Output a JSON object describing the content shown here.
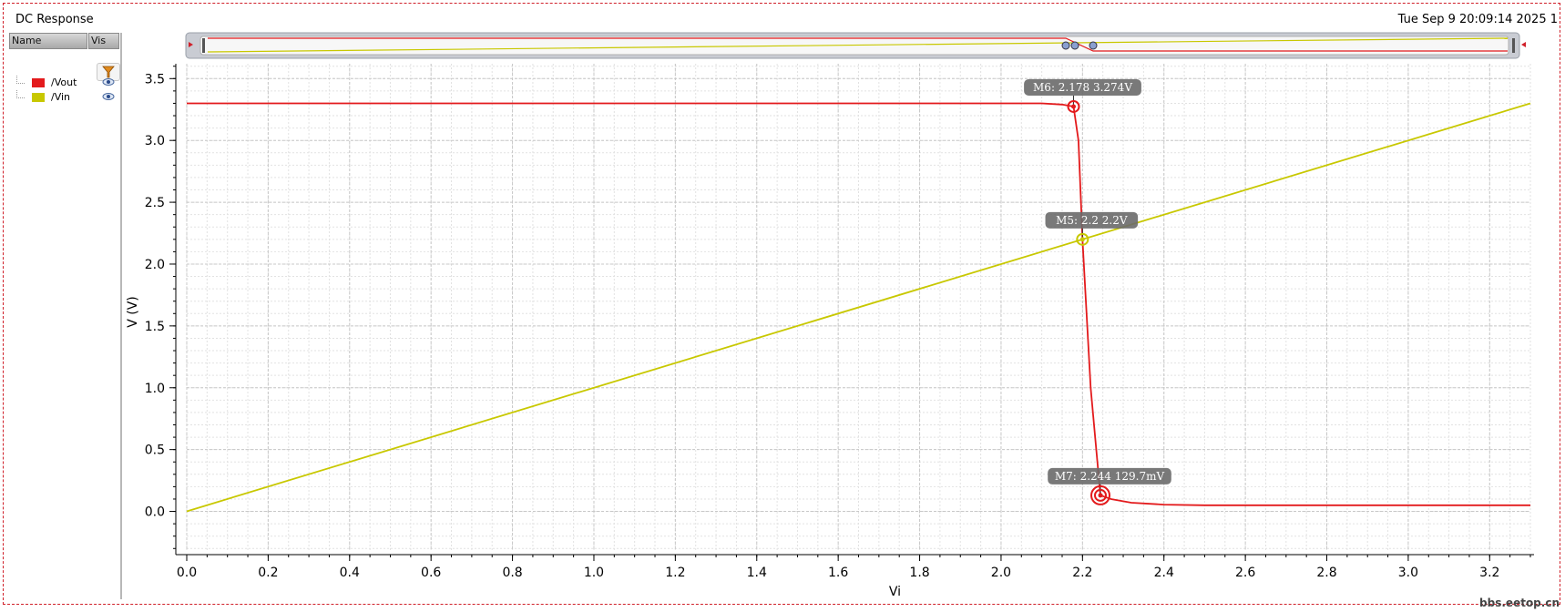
{
  "window": {
    "title": "DC Response",
    "datestamp": "Tue Sep 9 20:09:14 2025  1",
    "watermark": "bbs.eetop.cn"
  },
  "legend": {
    "headers": {
      "name": "Name",
      "vis": "Vis"
    },
    "items": [
      {
        "label": "/Vout",
        "color": "#e31a1c"
      },
      {
        "label": "/Vin",
        "color": "#c8c800"
      }
    ]
  },
  "chart_data": {
    "type": "line",
    "xlabel": "Vi",
    "ylabel": "V (V)",
    "xlim": [
      0.0,
      3.3
    ],
    "ylim": [
      -0.32,
      3.62
    ],
    "xticks": [
      "0.0",
      "0.2",
      "0.4",
      "0.6",
      "0.8",
      "1.0",
      "1.2",
      "1.4",
      "1.6",
      "1.8",
      "2.0",
      "2.2",
      "2.4",
      "2.6",
      "2.8",
      "3.0",
      "3.2"
    ],
    "yticks": [
      "0.0",
      "0.5",
      "1.0",
      "1.5",
      "2.0",
      "2.5",
      "3.0",
      "3.5"
    ],
    "grid": true,
    "series": [
      {
        "name": "/Vout",
        "color": "#e31a1c",
        "x": [
          0.0,
          2.1,
          2.15,
          2.178,
          2.19,
          2.2,
          2.22,
          2.244,
          2.27,
          2.32,
          2.4,
          2.5,
          3.3
        ],
        "y": [
          3.3,
          3.3,
          3.29,
          3.274,
          3.0,
          2.2,
          1.0,
          0.1297,
          0.1,
          0.07,
          0.055,
          0.05,
          0.05
        ]
      },
      {
        "name": "/Vin",
        "color": "#c8c800",
        "x": [
          0.0,
          3.3
        ],
        "y": [
          0.0,
          3.3
        ]
      }
    ],
    "markers": [
      {
        "label": "M6: 2.178 3.274V",
        "x": 2.178,
        "y": 3.274,
        "color": "#e31a1c"
      },
      {
        "label": "M5: 2.2 2.2V",
        "x": 2.2,
        "y": 2.2,
        "color": "#c8c800"
      },
      {
        "label": "M7: 2.244 129.7mV",
        "x": 2.244,
        "y": 0.1297,
        "color": "#e31a1c"
      }
    ]
  }
}
